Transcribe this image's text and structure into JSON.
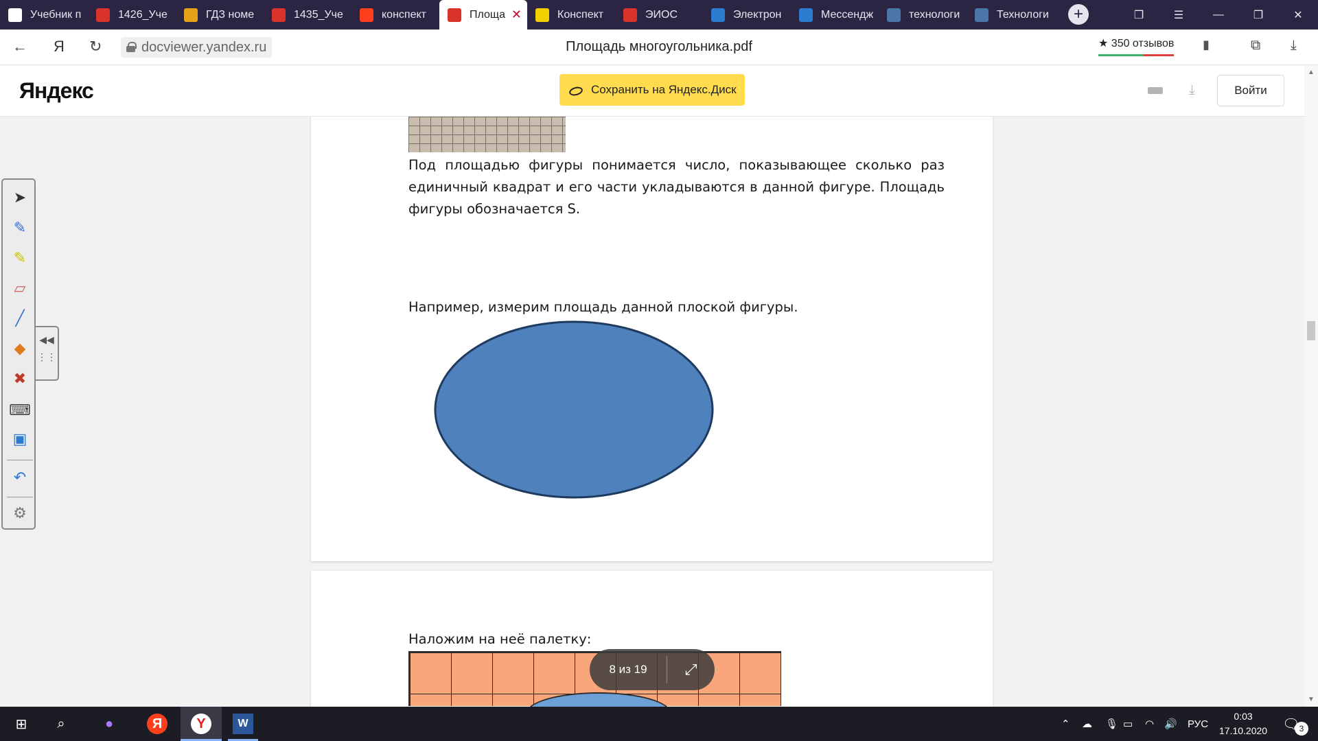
{
  "browser": {
    "tabs": [
      {
        "title": "Учебник п",
        "icon": "document-icon",
        "icon_color": "#ffffff"
      },
      {
        "title": "1426_Уче",
        "icon": "pdf-icon",
        "icon_color": "#d9332b"
      },
      {
        "title": "ГДЗ номе",
        "icon": "gdz-icon",
        "icon_color": "#e8a21a"
      },
      {
        "title": "1435_Уче",
        "icon": "pdf-icon",
        "icon_color": "#d9332b"
      },
      {
        "title": "конспект",
        "icon": "yandex-icon",
        "icon_color": "#fc3f1d"
      },
      {
        "title": "Площа",
        "icon": "pdf-outline-icon",
        "icon_color": "#d9332b",
        "active": true
      },
      {
        "title": "Конспект",
        "icon": "info-icon",
        "icon_color": "#f0d000"
      },
      {
        "title": "ЭИОС",
        "icon": "eios-icon",
        "icon_color": "#d9332b"
      },
      {
        "title": "Электрон",
        "icon": "t-circle-icon",
        "icon_color": "#2b7bd1"
      },
      {
        "title": "Мессендж",
        "icon": "chat-icon",
        "icon_color": "#2b7bd1"
      },
      {
        "title": "технологи",
        "icon": "vk-icon",
        "icon_color": "#4a76a8"
      },
      {
        "title": "Технологи",
        "icon": "vk-icon",
        "icon_color": "#4a76a8"
      }
    ],
    "new_tab_label": "+",
    "url": "docviewer.yandex.ru",
    "page_title": "Площадь многоугольника.pdf",
    "reviews": "★ 350 отзывов",
    "yandex_short": "Я"
  },
  "viewer": {
    "logo": "Яндекс",
    "save_button": "Сохранить на Яндекс.Диск",
    "login_button": "Войти",
    "page_indicator": "8 из 19"
  },
  "document": {
    "paragraph1": "Под площадью фигуры понимается число, показывающее сколько раз единичный квадрат и его части укладываются в данной фигуре. Площадь фигуры обозначается S.",
    "paragraph2": "Например, измерим площадь данной плоской фигуры.",
    "paragraph3": "Наложим на неё палетку:",
    "ellipse_fill": "#4f81bd",
    "ellipse_stroke": "#1f3a5f",
    "palette_fill": "#f9a67a"
  },
  "taskbar": {
    "language": "РУС",
    "time": "0:03",
    "date": "17.10.2020",
    "notifications": "3"
  }
}
